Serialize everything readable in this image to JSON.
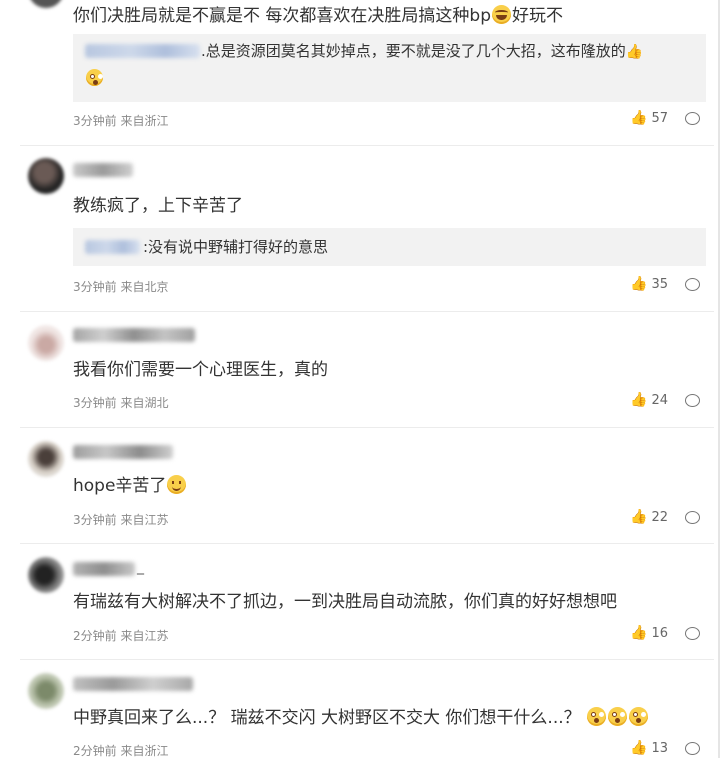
{
  "comments": [
    {
      "text_a": "你们决胜局就是不赢是不 每次都喜欢在决胜局搞这种bp",
      "emoji_a": "laugh-emoji",
      "text_b": "好玩不",
      "reply_text": ".总是资源团莫名其妙掉点，要不就是没了几个大招，这布隆放的",
      "reply_emoji_a": "thumbs-up-emoji",
      "reply_emoji_b": "shock-emoji",
      "time": "3分钟前",
      "location": "来自浙江",
      "likes": "57"
    },
    {
      "text_a": "教练疯了，上下辛苦了",
      "reply_text": ":没有说中野辅打得好的意思",
      "time": "3分钟前",
      "location": "来自北京",
      "likes": "35"
    },
    {
      "text_a": "我看你们需要一个心理医生，真的",
      "time": "3分钟前",
      "location": "来自湖北",
      "likes": "24"
    },
    {
      "text_a": "hope辛苦了",
      "emoji_a": "smile-emoji",
      "time": "3分钟前",
      "location": "来自江苏",
      "likes": "22"
    },
    {
      "username_suffix": "_",
      "text_a": "有瑞兹有大树解决不了抓边，一到决胜局自动流脓，你们真的好好想想吧",
      "time": "2分钟前",
      "location": "来自江苏",
      "likes": "16"
    },
    {
      "text_a": "中野真回来了么...？ 瑞兹不交闪 大树野区不交大 你们想干什么...？",
      "emoji_a": "shock-emoji",
      "time": "2分钟前",
      "location": "来自浙江",
      "likes": "13"
    }
  ],
  "icons": {
    "like": "thumbs-up-icon",
    "reply": "comment-icon"
  }
}
